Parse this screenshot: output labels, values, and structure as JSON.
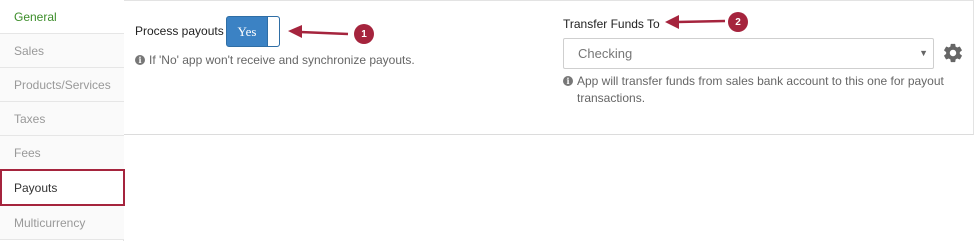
{
  "sidebar": {
    "items": [
      {
        "label": "General"
      },
      {
        "label": "Sales"
      },
      {
        "label": "Products/Services"
      },
      {
        "label": "Taxes"
      },
      {
        "label": "Fees"
      },
      {
        "label": "Payouts"
      },
      {
        "label": "Multicurrency"
      }
    ]
  },
  "process_payouts": {
    "label": "Process payouts",
    "toggle_value": "Yes",
    "help": "If 'No' app won't receive and synchronize payouts."
  },
  "transfer_funds": {
    "label": "Transfer Funds To",
    "selected": "Checking",
    "help": "App will transfer funds from sales bank account to this one for payout transactions."
  },
  "annotations": {
    "badge_1": "1",
    "badge_2": "2",
    "color": "#a5243d"
  },
  "icons": {
    "info": "info-circle-icon",
    "gear": "gear-icon",
    "caret": "caret-down-icon"
  }
}
